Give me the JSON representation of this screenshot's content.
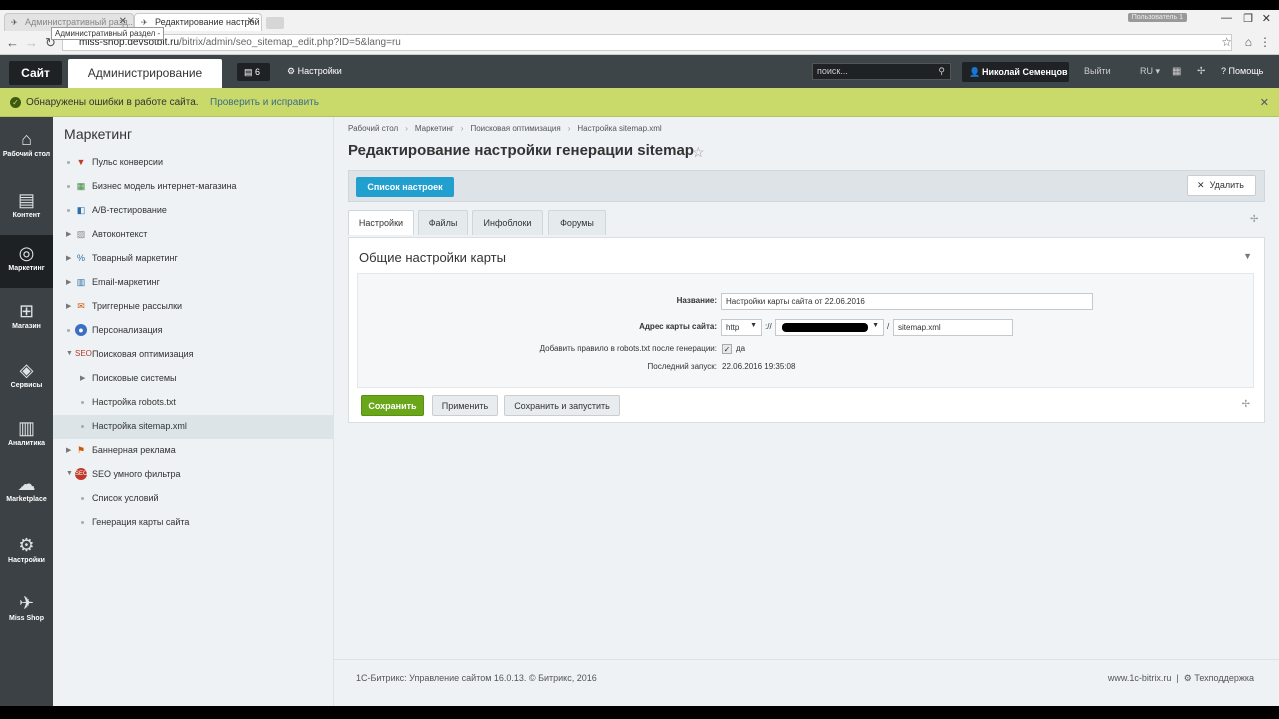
{
  "browser": {
    "tabs": [
      {
        "title": "Административный разд..."
      },
      {
        "title": "Редактирование настрой"
      }
    ],
    "tooltip": "Административный раздел -",
    "user_badge": "Пользователь 1",
    "url_host": "miss-shop.devsotbit.ru",
    "url_path": "/bitrix/admin/seo_sitemap_edit.php?ID=5&lang=ru"
  },
  "panel": {
    "site_label": "Сайт",
    "admin_label": "Администрирование",
    "notif_count": "6",
    "settings_label": "Настройки",
    "search_placeholder": "поиск...",
    "user_name": "Николай Семенцов",
    "logout_label": "Выйти",
    "lang_label": "RU",
    "help_label": "Помощь"
  },
  "warning": {
    "text": "Обнаружены ошибки в работе сайта.",
    "link": "Проверить и исправить"
  },
  "left_menu": {
    "items": [
      {
        "label": "Рабочий стол",
        "icon": "home-icon"
      },
      {
        "label": "Контент",
        "icon": "document-icon"
      },
      {
        "label": "Маркетинг",
        "icon": "target-icon"
      },
      {
        "label": "Магазин",
        "icon": "basket-icon"
      },
      {
        "label": "Сервисы",
        "icon": "layers-icon"
      },
      {
        "label": "Аналитика",
        "icon": "bar-chart-icon"
      },
      {
        "label": "Marketplace",
        "icon": "cloud-icon"
      },
      {
        "label": "Настройки",
        "icon": "gear-icon"
      },
      {
        "label": "Miss Shop",
        "icon": "shop-logo-icon"
      }
    ]
  },
  "sidebar": {
    "title": "Маркетинг",
    "items": [
      {
        "label": "Пульс конверсии"
      },
      {
        "label": "Бизнес модель интернет-магазина"
      },
      {
        "label": "A/B-тестирование"
      },
      {
        "label": "Автоконтекст"
      },
      {
        "label": "Товарный маркетинг"
      },
      {
        "label": "Email-маркетинг"
      },
      {
        "label": "Триггерные рассылки"
      },
      {
        "label": "Персонализация"
      },
      {
        "label": "Поисковая оптимизация"
      },
      {
        "label": "Поисковые системы"
      },
      {
        "label": "Настройка robots.txt"
      },
      {
        "label": "Настройка sitemap.xml"
      },
      {
        "label": "Баннерная реклама"
      },
      {
        "label": "SEO умного фильтра"
      },
      {
        "label": "Список условий"
      },
      {
        "label": "Генерация карты сайта"
      }
    ]
  },
  "main": {
    "breadcrumbs": [
      "Рабочий стол",
      "Маркетинг",
      "Поисковая оптимизация",
      "Настройка sitemap.xml"
    ],
    "title": "Редактирование настройки генерации sitemap",
    "list_button": "Список настроек",
    "delete_button": "Удалить",
    "tabs": [
      "Настройки",
      "Файлы",
      "Инфоблоки",
      "Форумы"
    ],
    "section_title": "Общие настройки карты",
    "fields": {
      "name_label": "Название:",
      "name_value": "Настройки карты сайта от 22.06.2016",
      "address_label": "Адрес карты сайта:",
      "protocol": "http",
      "protocol_sep": "://",
      "path_sep": "/",
      "file_value": "sitemap.xml",
      "robots_label": "Добавить правило в robots.txt после генерации:",
      "robots_value": "да",
      "robots_checked": true,
      "last_run_label": "Последний запуск:",
      "last_run_value": "22.06.2016 19:35:08"
    },
    "buttons": {
      "save": "Сохранить",
      "apply": "Применить",
      "save_run": "Сохранить и запустить"
    }
  },
  "footer": {
    "left": "1С-Битрикс: Управление сайтом 16.0.13. © Битрикс, 2016",
    "site_link": "www.1c-bitrix.ru",
    "support": "Техподдержка"
  },
  "colors": {
    "accent_blue": "#21a0cf",
    "save_green": "#6aa619",
    "warning_bg": "#c9d96a",
    "panel_bg": "#3e4549"
  }
}
